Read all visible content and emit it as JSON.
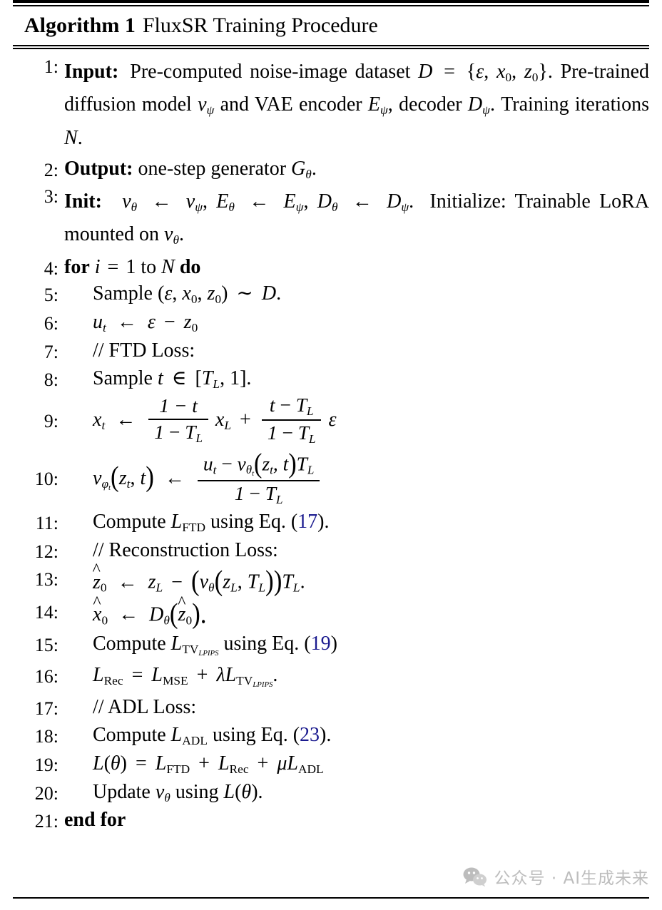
{
  "title": {
    "label": "Algorithm 1",
    "name": "FluxSR Training Procedure"
  },
  "lines": [
    {
      "number": "1:",
      "keyword": "Input:",
      "text": "Pre-computed noise-image dataset D = {ε, x₀, z₀}. Pre-trained diffusion model v_ψ and VAE encoder E_ψ, decoder D_ψ. Training iterations N.",
      "parts": {
        "p1": "Pre-computed noise-image dataset",
        "sym_D": "D",
        "eq": "=",
        "set_open": "{",
        "eps": "ε",
        "comma1": ",",
        "x": "x",
        "x_sub": "0",
        "comma2": ",",
        "z": "z",
        "z_sub": "0",
        "set_close": "}.",
        "p2": "Pre-trained diffusion model",
        "v": "v",
        "v_sub": "ψ",
        "p3": "and VAE encoder",
        "E": "E",
        "E_sub": "ψ",
        "p4": ", decoder",
        "Dd": "D",
        "Dd_sub": "ψ",
        "p5": ". Training iterations",
        "N": "N",
        "period": "."
      }
    },
    {
      "number": "2:",
      "keyword": "Output:",
      "parts": {
        "p1": "one-step generator",
        "G": "G",
        "G_sub": "θ",
        "period": "."
      }
    },
    {
      "number": "3:",
      "keyword": "Init:",
      "parts": {
        "v1": "v",
        "v1_sub": "θ",
        "arrow1": "←",
        "v2": "v",
        "v2_sub": "ψ",
        "c1": ",",
        "E1": "E",
        "E1_sub": "θ",
        "arrow2": "←",
        "E2": "E",
        "E2_sub": "ψ",
        "c2": ",",
        "D1": "D",
        "D1_sub": "θ",
        "arrow3": "←",
        "D2": "D",
        "D2_sub": "ψ",
        "stop": ".",
        "p1": "Initialize: Trainable LoRA mounted on",
        "v3": "v",
        "v3_sub": "θ",
        "period": "."
      }
    },
    {
      "number": "4:",
      "parts": {
        "kw_for": "for",
        "i": "i",
        "eq": "=",
        "one": "1",
        "to": "to",
        "N": "N",
        "kw_do": "do"
      }
    },
    {
      "number": "5:",
      "parts": {
        "p1": "Sample",
        "open": "(",
        "eps": "ε",
        "c1": ",",
        "x": "x",
        "x_sub": "0",
        "c2": ",",
        "z": "z",
        "z_sub": "0",
        "close": ")",
        "sim": "∼",
        "D": "D",
        "period": "."
      }
    },
    {
      "number": "6:",
      "parts": {
        "u": "u",
        "u_sub": "t",
        "arrow": "←",
        "eps": "ε",
        "minus": "−",
        "z": "z",
        "z_sub": "0"
      }
    },
    {
      "number": "7:",
      "parts": {
        "comment": "// FTD Loss:"
      }
    },
    {
      "number": "8:",
      "parts": {
        "p1": "Sample",
        "t": "t",
        "in": "∈",
        "open": "[",
        "T": "T",
        "T_sub": "L",
        "comma": ",",
        "one": "1",
        "close": "].",
        "period": ""
      }
    },
    {
      "number": "9:",
      "parts": {
        "x": "x",
        "x_sub": "t",
        "arrow": "←",
        "frac1_num": "1 − t",
        "frac1_den": "1 − T_L",
        "xL": "x",
        "xL_sub": "L",
        "plus": "+",
        "frac2_num": "t − T_L",
        "frac2_den": "1 − T_L",
        "eps": "ε"
      }
    },
    {
      "number": "10:",
      "parts": {
        "v": "v",
        "v_sub_phi": "φ",
        "v_sub_t": "t",
        "args": "(z_t, t)",
        "arrow": "←",
        "num": "u_t − v_{θ_t}(z_t, t)T_L",
        "den": "1 − T_L"
      }
    },
    {
      "number": "11:",
      "parts": {
        "p1": "Compute",
        "L": "L",
        "L_sub": "FTD",
        "p2": "using Eq. (",
        "ref": "17",
        "p3": ")."
      }
    },
    {
      "number": "12:",
      "parts": {
        "comment": "// Reconstruction Loss:"
      }
    },
    {
      "number": "13:",
      "parts": {
        "zhat": "z",
        "zhat_sub": "0",
        "arrow": "←",
        "zL": "z",
        "zL_sub": "L",
        "minus": "−",
        "open": "(",
        "v": "v",
        "v_sub": "θ",
        "iopen": "(",
        "zL2": "z",
        "zL2_sub": "L",
        "comma": ",",
        "T": "T",
        "T_sub": "L",
        "iclose": ")",
        "close": ")",
        "TL": "T",
        "TL_sub": "L",
        "period": "."
      }
    },
    {
      "number": "14:",
      "parts": {
        "xhat": "x",
        "xhat_sub": "0",
        "arrow": "←",
        "D": "D",
        "D_sub": "θ",
        "open": "(",
        "zhat": "z",
        "zhat_sub": "0",
        "close": ").",
        "period": ""
      }
    },
    {
      "number": "15:",
      "parts": {
        "p1": "Compute",
        "L": "L",
        "L_sub_tv": "TV",
        "L_sub_lpips": "LPIPS",
        "p2": "using Eq. (",
        "ref": "19",
        "p3": ")"
      }
    },
    {
      "number": "16:",
      "parts": {
        "L1": "L",
        "L1_sub": "Rec",
        "eq": "=",
        "L2": "L",
        "L2_sub": "MSE",
        "plus": "+",
        "lambda": "λ",
        "L3": "L",
        "L3_sub_tv": "TV",
        "L3_sub_lpips": "LPIPS",
        "period": "."
      }
    },
    {
      "number": "17:",
      "parts": {
        "comment": "// ADL Loss:"
      }
    },
    {
      "number": "18:",
      "parts": {
        "p1": "Compute",
        "L": "L",
        "L_sub": "ADL",
        "p2": "using Eq. (",
        "ref": "23",
        "p3": ")."
      }
    },
    {
      "number": "19:",
      "parts": {
        "L": "L",
        "open": "(",
        "theta": "θ",
        "close": ")",
        "eq": "=",
        "L1": "L",
        "L1_sub": "FTD",
        "plus1": "+",
        "L2": "L",
        "L2_sub": "Rec",
        "plus2": "+",
        "mu": "μ",
        "L3": "L",
        "L3_sub": "ADL"
      }
    },
    {
      "number": "20:",
      "parts": {
        "p1": "Update",
        "v": "v",
        "v_sub": "θ",
        "p2": "using",
        "L": "L",
        "open": "(",
        "theta": "θ",
        "close": ").",
        "period": ""
      }
    },
    {
      "number": "21:",
      "parts": {
        "kw_end_for": "end for"
      }
    }
  ],
  "watermark": {
    "text": "公众号 · AI生成未来",
    "icon": "wechat-icon",
    "color": "#bdbdbd"
  },
  "colors": {
    "eqref": "#1b1b8f",
    "text": "#000000",
    "background": "#ffffff"
  }
}
